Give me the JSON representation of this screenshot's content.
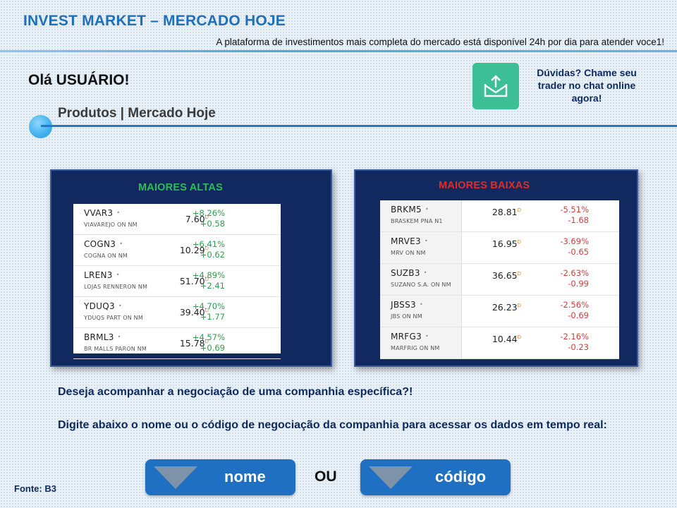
{
  "header": {
    "title": "INVEST MARKET – MERCADO HOJE",
    "subtitle": "A plataforma de investimentos mais completa do mercado está disponível  24h por dia para atender voce1!"
  },
  "greeting": "Olá USUÁRIO!",
  "section_title": "Produtos | Mercado Hoje",
  "help": {
    "icon": "mail-upload-icon",
    "text": "Dúvidas? Chame seu trader no chat online agora!",
    "icon_color": "#3dbf95"
  },
  "altas": {
    "title": "MAIORES ALTAS",
    "title_color": "#2ebd55",
    "rows": [
      {
        "ticker": "VVAR3",
        "company": "VIAVAREJO ON NM",
        "price": "7.60",
        "pct": "+8.26%",
        "abs": "+0.58"
      },
      {
        "ticker": "COGN3",
        "company": "COGNA ON NM",
        "price": "10.29",
        "pct": "+6.41%",
        "abs": "+0.62"
      },
      {
        "ticker": "LREN3",
        "company": "LOJAS RENNERON NM",
        "price": "51.70",
        "pct": "+4.89%",
        "abs": "+2.41"
      },
      {
        "ticker": "YDUQ3",
        "company": "YDUQS PART ON NM",
        "price": "39.40",
        "pct": "+4.70%",
        "abs": "+1.77"
      },
      {
        "ticker": "BRML3",
        "company": "BR MALLS PARON NM",
        "price": "15.78",
        "pct": "+4.57%",
        "abs": "+0.69"
      }
    ]
  },
  "baixas": {
    "title": "MAIORES BAIXAS",
    "title_color": "#e02b26",
    "rows": [
      {
        "ticker": "BRKM5",
        "company": "BRASKEM PNA N1",
        "price": "28.81",
        "pct": "-5.51%",
        "abs": "-1.68"
      },
      {
        "ticker": "MRVE3",
        "company": "MRV ON NM",
        "price": "16.95",
        "pct": "-3.69%",
        "abs": "-0.65"
      },
      {
        "ticker": "SUZB3",
        "company": "SUZANO S.A. ON NM",
        "price": "36.65",
        "pct": "-2.63%",
        "abs": "-0.99"
      },
      {
        "ticker": "JBSS3",
        "company": "JBS ON NM",
        "price": "26.23",
        "pct": "-2.56%",
        "abs": "-0.69"
      },
      {
        "ticker": "MRFG3",
        "company": "MARFRIG ON NM",
        "price": "10.44",
        "pct": "-2.16%",
        "abs": "-0.23"
      }
    ]
  },
  "price_marker": "D",
  "star_symbol": "•",
  "question": "Deseja acompanhar a negociação de uma companhia específica?!",
  "instruction": "Digite abaixo o nome ou o código de negociação da companhia para acessar os dados em tempo real:",
  "buttons": {
    "nome": "nome",
    "ou": "OU",
    "codigo": "código",
    "color": "#1f6fc3"
  },
  "source": "Fonte: B3"
}
